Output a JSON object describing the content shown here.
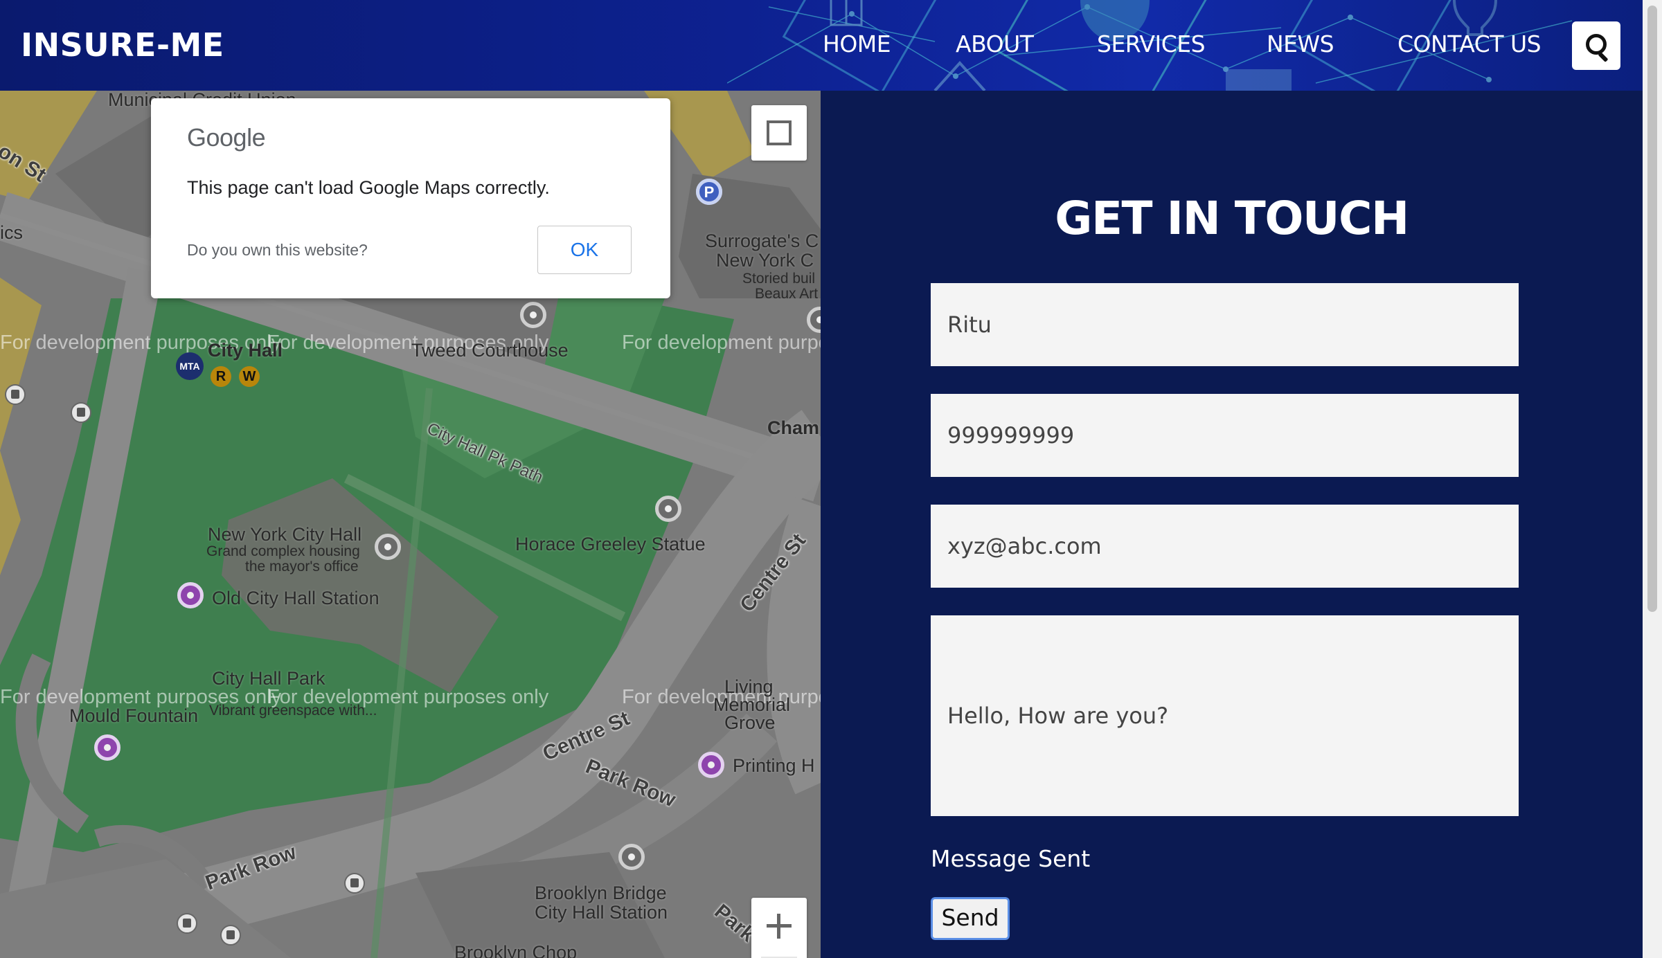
{
  "header": {
    "logo": "INSURE-ME",
    "nav": [
      {
        "label": "HOME"
      },
      {
        "label": "ABOUT"
      },
      {
        "label": "SERVICES"
      },
      {
        "label": "NEWS"
      },
      {
        "label": "CONTACT US"
      }
    ],
    "search_icon": "search-icon"
  },
  "map": {
    "labels": {
      "municipal": "Municipal Credit Union",
      "surrogates": "Surrogate's C",
      "new_york_c": "New York C",
      "storied": "Storied buil",
      "beaux": "Beaux Art",
      "city_hall": "City Hall",
      "tweed": "Tweed Courthouse",
      "chambers": "Cham",
      "pk_path": "City Hall Pk Path",
      "nych": "New York City Hall",
      "nych_sub1": "Grand complex housing",
      "nych_sub2": "the mayor's office",
      "horace": "Horace Greeley Statue",
      "old_station": "Old City Hall Station",
      "centre_st_1": "Centre St",
      "centre_st_2": "Centre St",
      "park": "City Hall Park",
      "park_sub": "Vibrant greenspace with...",
      "mould": "Mould Fountain",
      "living": "Living",
      "memorial": "Memorial",
      "grove": "Grove",
      "printing": "Printing H",
      "park_row_1": "Park Row",
      "park_row_2": "Park Row",
      "park_row_3": "Park",
      "brooklyn_bridge": "Brooklyn Bridge",
      "city_hall_station": "City Hall Station",
      "brooklyn_chop": "Brooklyn Chop",
      "on_st": "on St",
      "ics": "ics"
    },
    "watermark": "For development purposes only",
    "subway_lines": [
      "R",
      "W"
    ],
    "metro_badge": "MTA",
    "parking": "P"
  },
  "dialog": {
    "brand": "Google",
    "message": "This page can't load Google Maps correctly.",
    "question": "Do you own this website?",
    "ok_label": "OK"
  },
  "contact": {
    "title": "GET IN TOUCH",
    "name_value": "Ritu",
    "phone_value": "999999999",
    "email_value": "xyz@abc.com",
    "message_value": "Hello, How are you?",
    "status": "Message Sent",
    "send_label": "Send"
  },
  "colors": {
    "panel_bg": "#0b1a52",
    "header_bg": "#0d2190",
    "field_bg": "#f4f4f4",
    "map_green": "#3f7f4f",
    "accent_blue": "#1a73e8"
  }
}
